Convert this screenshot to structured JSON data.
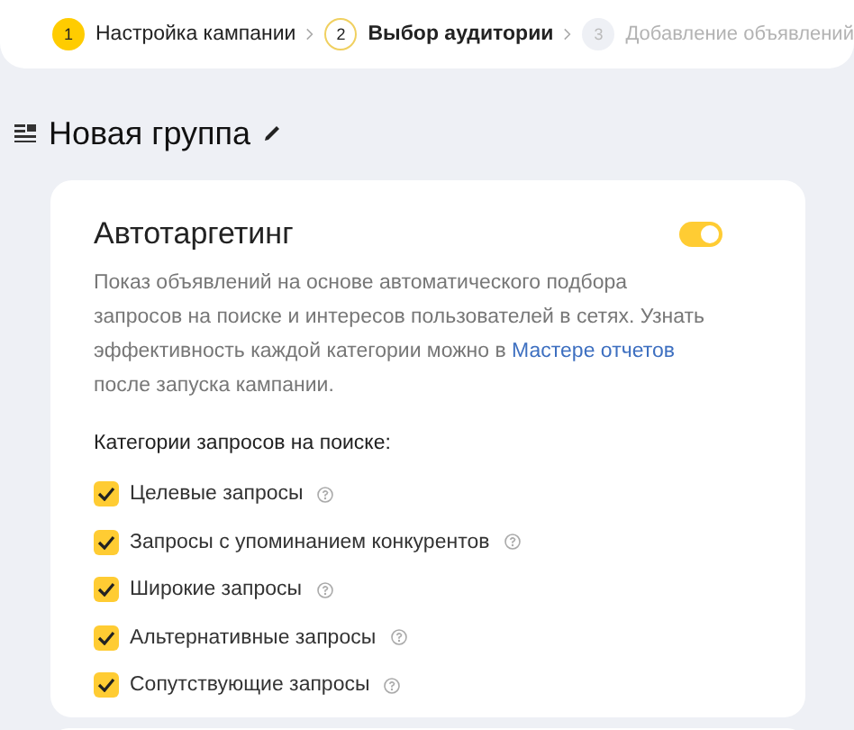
{
  "steps": [
    {
      "number": "1",
      "label": "Настройка кампании",
      "done": true,
      "selected": false
    },
    {
      "number": "2",
      "label": "Выбор аудитории",
      "done": false,
      "selected": true
    },
    {
      "number": "3",
      "label": "Добавление объявлений",
      "done": false,
      "selected": false
    }
  ],
  "group": {
    "title": "Новая группа"
  },
  "card": {
    "title": "Автотаргетинг",
    "toggle_on": true,
    "description": {
      "before": "Показ объявлений на основе автоматического подбора запросов на поиске и интересов пользователей в сетях. Узнать эффективность каждой категории можно в ",
      "link": "Мастере отчетов",
      "after": " после запуска кампании."
    },
    "categories_label": "Категории запросов на поиске:",
    "categories": [
      {
        "label": "Целевые запросы",
        "checked": true
      },
      {
        "label": "Запросы с упоминанием конкурентов",
        "checked": true
      },
      {
        "label": "Широкие запросы",
        "checked": true
      },
      {
        "label": "Альтернативные запросы",
        "checked": true
      },
      {
        "label": "Сопутствующие запросы",
        "checked": true
      }
    ]
  }
}
